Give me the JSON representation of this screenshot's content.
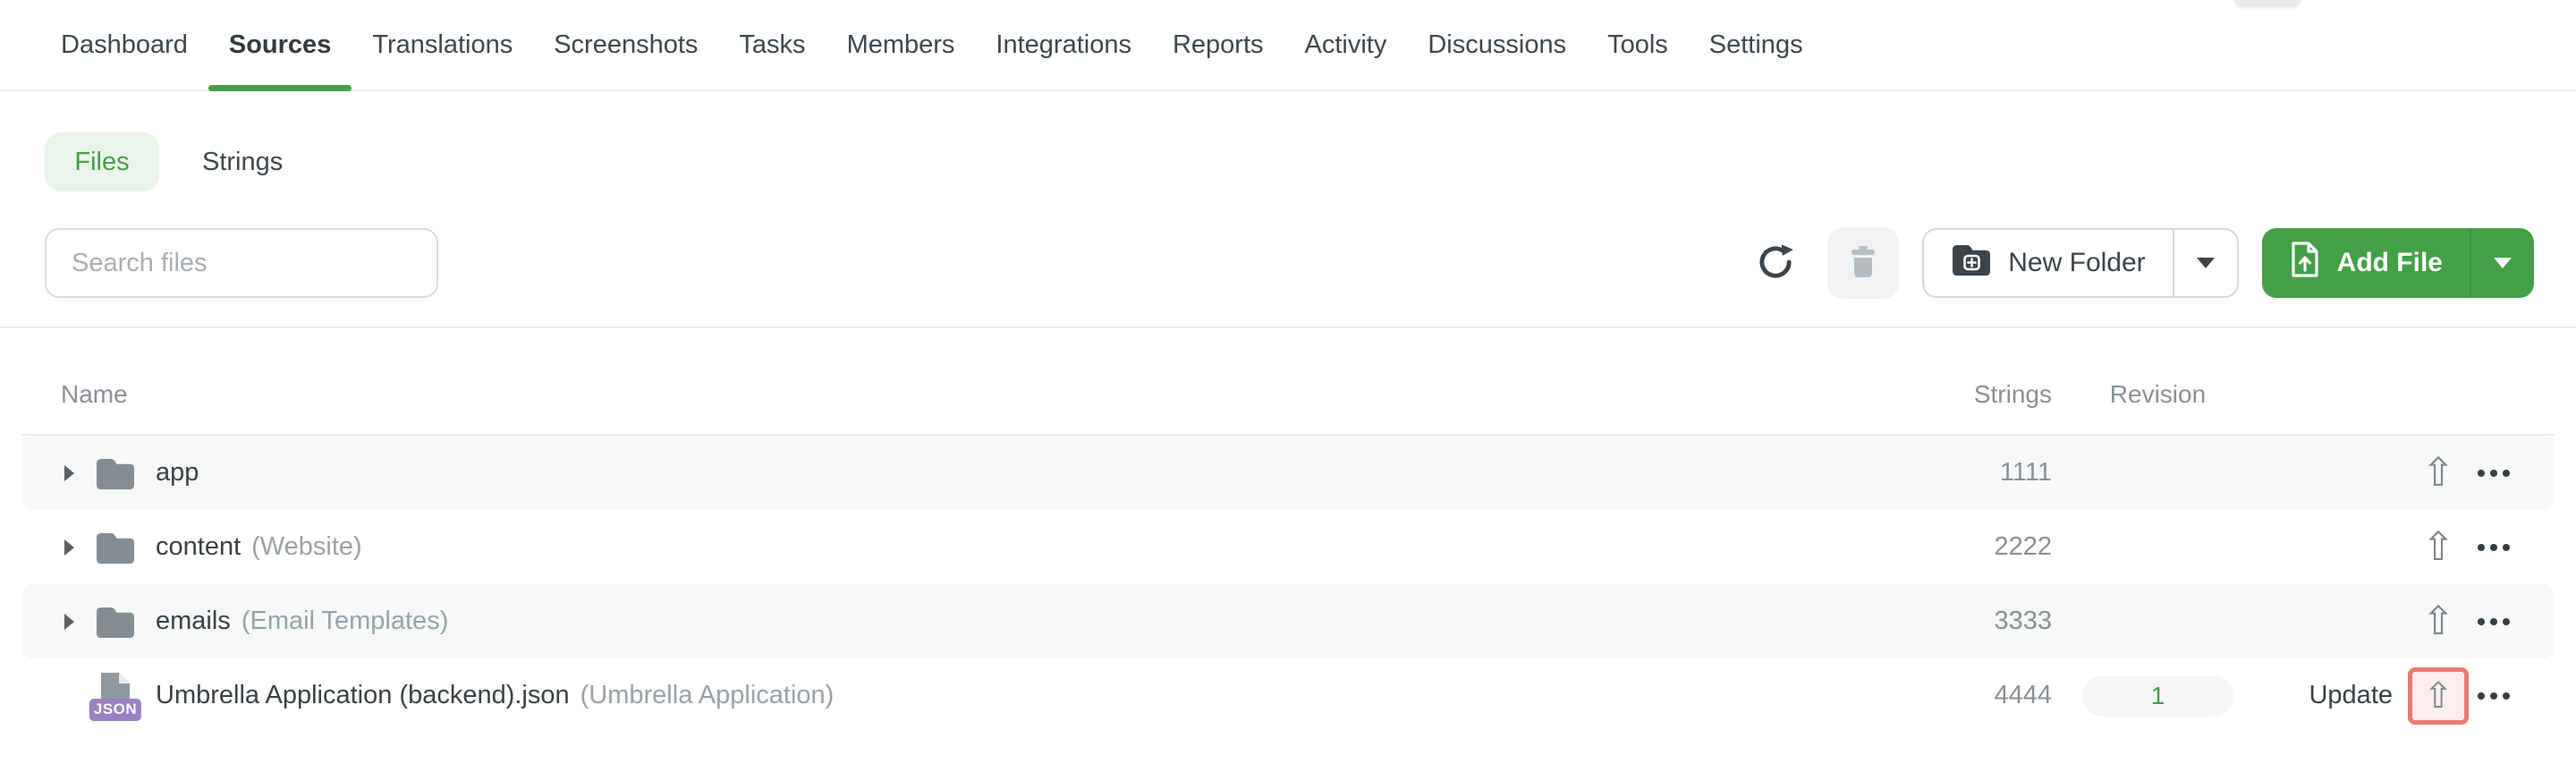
{
  "nav": {
    "items": [
      {
        "label": "Dashboard",
        "active": false
      },
      {
        "label": "Sources",
        "active": true
      },
      {
        "label": "Translations",
        "active": false
      },
      {
        "label": "Screenshots",
        "active": false
      },
      {
        "label": "Tasks",
        "active": false
      },
      {
        "label": "Members",
        "active": false
      },
      {
        "label": "Integrations",
        "active": false
      },
      {
        "label": "Reports",
        "active": false
      },
      {
        "label": "Activity",
        "active": false
      },
      {
        "label": "Discussions",
        "active": false
      },
      {
        "label": "Tools",
        "active": false
      },
      {
        "label": "Settings",
        "active": false
      }
    ]
  },
  "view_toggle": {
    "files_label": "Files",
    "strings_label": "Strings",
    "active": "Files"
  },
  "toolbar": {
    "search_placeholder": "Search files",
    "new_folder_label": "New Folder",
    "add_file_label": "Add File"
  },
  "table": {
    "headers": {
      "name": "Name",
      "strings": "Strings",
      "revision": "Revision"
    },
    "rows": [
      {
        "kind": "folder",
        "name": "app",
        "note": "",
        "strings": "1111"
      },
      {
        "kind": "folder",
        "name": "content",
        "note": "(Website)",
        "strings": "2222"
      },
      {
        "kind": "folder",
        "name": "emails",
        "note": "(Email Templates)",
        "strings": "3333"
      },
      {
        "kind": "file",
        "name": "Umbrella Application (backend).json",
        "note": "(Umbrella Application)",
        "strings": "4444",
        "revision": "1",
        "update_label": "Update",
        "badge": "JSON",
        "upload_highlighted": true
      }
    ]
  },
  "icons": {
    "upload_glyph": "⇧"
  },
  "colors": {
    "accent_green": "#43a047",
    "accent_green_bg": "#e9f4ea",
    "highlight_border": "#ee7b73",
    "highlight_bg": "#fdeeee",
    "json_badge": "#9b80c2"
  }
}
